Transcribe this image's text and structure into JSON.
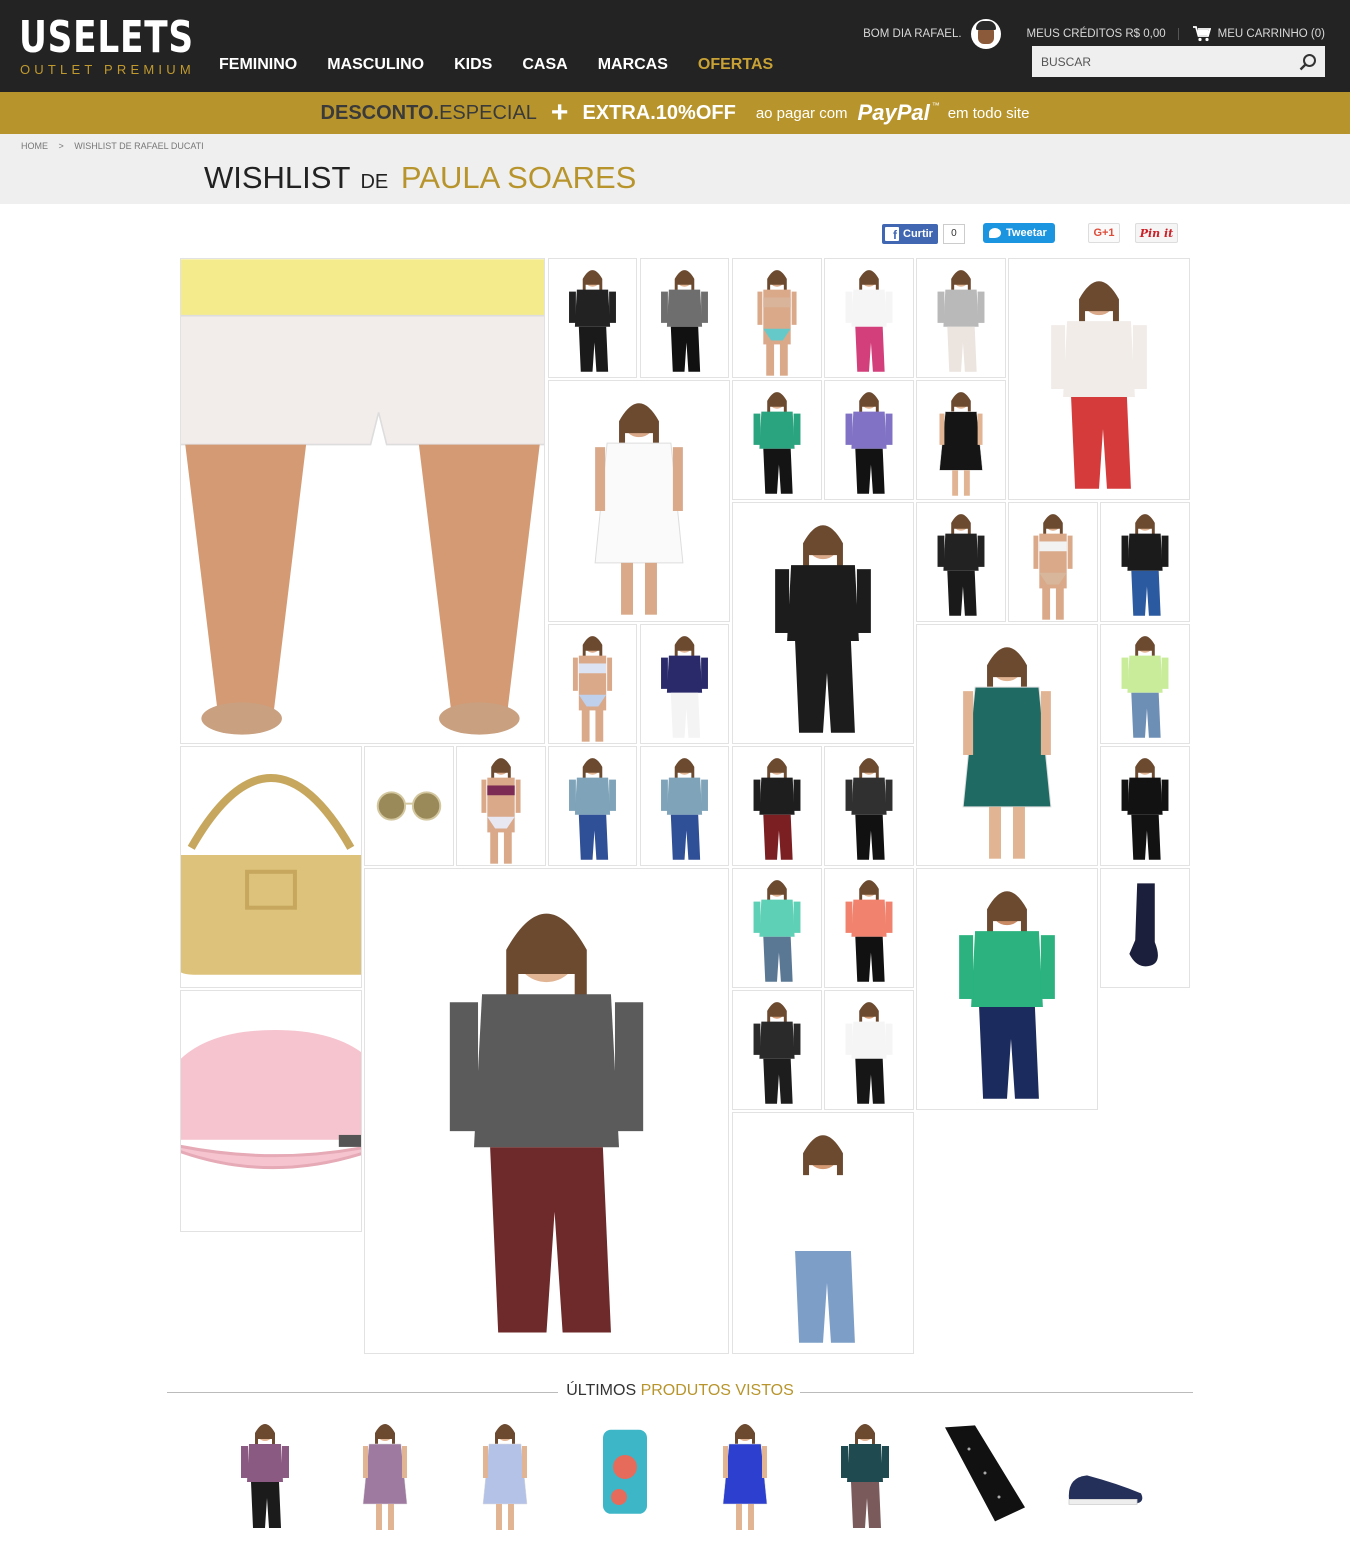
{
  "header": {
    "logo_main": "USELETS",
    "logo_sub": "OUTLET PREMIUM",
    "greeting": "BOM DIA RAFAEL.",
    "credits": "MEUS CRÉDITOS R$ 0,00",
    "cart": "MEU CARRINHO (0)",
    "search_placeholder": "BUSCAR",
    "nav": [
      "FEMININO",
      "MASCULINO",
      "KIDS",
      "CASA",
      "MARCAS",
      "OFERTAS"
    ]
  },
  "promo": {
    "part1": "DESCONTO.",
    "part2": "ESPECIAL",
    "plus": "+",
    "part3": "EXTRA.10%OFF",
    "part4": "ao pagar com",
    "paypal": "PayPal",
    "tm": "™",
    "part5": "em todo site"
  },
  "breadcrumb": [
    "HOME",
    ">",
    "WISHLIST DE RAFAEL DUCATI"
  ],
  "page_title": {
    "prefix": "WISHLIST",
    "de": "DE",
    "name": "PAULA SOARES"
  },
  "social": {
    "facebook_label": "Curtir",
    "facebook_count": "0",
    "twitter_label": "Tweetar",
    "gplus_label": "G+1",
    "pinterest_label": "Pin it"
  },
  "recent": {
    "title_a": "ÚLTIMOS",
    "title_b": "PRODUTOS VISTOS"
  },
  "colors": {
    "header_bg": "#232323",
    "accent": "#b8952c",
    "title_band": "#efefef"
  },
  "tiles": [
    {
      "type": "model-shorts",
      "top": "#f4ec8c",
      "bottom": "#f2ecea",
      "skin": "#d49a73"
    },
    {
      "type": "model-tee",
      "top": "#222222",
      "bottom": "#1a1a1a",
      "skin": "#e1b493"
    },
    {
      "type": "model-tee",
      "top": "#6e6e6e",
      "bottom": "#111111",
      "skin": "#e1b493"
    },
    {
      "type": "model-swim",
      "top": "#d9b49a",
      "bottom": "#66c9c9",
      "skin": "#d9a98a"
    },
    {
      "type": "model-tee",
      "top": "#f5f5f5",
      "bottom": "#d33f7b",
      "skin": "#e1b493"
    },
    {
      "type": "model-tee",
      "top": "#b9b9b9",
      "bottom": "#ece4de",
      "skin": "#e1b493"
    },
    {
      "type": "model-tee",
      "top": "#f1ece8",
      "bottom": "#d53b3b",
      "skin": "#d9a98a"
    },
    {
      "type": "model-dress",
      "top": "#fafafa",
      "bottom": "#fafafa",
      "skin": "#d9a98a"
    },
    {
      "type": "model-tee",
      "top": "#2aa37f",
      "bottom": "#141414",
      "skin": "#e1b493"
    },
    {
      "type": "model-tee",
      "top": "#8172c5",
      "bottom": "#121212",
      "skin": "#e1b493"
    },
    {
      "type": "model-dress",
      "top": "#151515",
      "bottom": "#151515",
      "skin": "#e1b493"
    },
    {
      "type": "model-tee",
      "top": "#1c1c1c",
      "bottom": "#1c1c1c",
      "skin": "#d9a98a"
    },
    {
      "type": "model-tee",
      "top": "#222222",
      "bottom": "#1a1a1a",
      "skin": "#e1b493"
    },
    {
      "type": "model-swim",
      "top": "#f2f2f2",
      "bottom": "#d8b69b",
      "skin": "#d9a98a"
    },
    {
      "type": "model-tee",
      "top": "#1b1b1b",
      "bottom": "#2c5aa0",
      "skin": "#e1b493"
    },
    {
      "type": "model-swim",
      "top": "#dce3f2",
      "bottom": "#bfd0ec",
      "skin": "#d9a98a"
    },
    {
      "type": "model-tee",
      "top": "#2a2a6b",
      "bottom": "#f4f4f4",
      "skin": "#e1b493"
    },
    {
      "type": "model-dress",
      "top": "#1f6b63",
      "bottom": "#1f6b63",
      "skin": "#e1b493"
    },
    {
      "type": "model-tee",
      "top": "#c9ec9b",
      "bottom": "#6e8fb5",
      "skin": "#e1b493"
    },
    {
      "type": "bag",
      "top": "#dcc27a",
      "bottom": "#c6a75d",
      "skin": "#ffffff"
    },
    {
      "type": "sunglasses",
      "top": "#d3c7a0",
      "bottom": "#9b8a59",
      "skin": "#ffffff"
    },
    {
      "type": "model-swim",
      "top": "#7c2c54",
      "bottom": "#e8e8f3",
      "skin": "#d9a98a"
    },
    {
      "type": "model-tee",
      "top": "#7fa3b9",
      "bottom": "#2f4f96",
      "skin": "#e1b493"
    },
    {
      "type": "model-tee",
      "top": "#7fa3b9",
      "bottom": "#2f4f96",
      "skin": "#e1b493"
    },
    {
      "type": "model-tee",
      "top": "#1e1e1e",
      "bottom": "#7c1f22",
      "skin": "#e1b493"
    },
    {
      "type": "model-tee",
      "top": "#303030",
      "bottom": "#111111",
      "skin": "#e1b493"
    },
    {
      "type": "model-tee",
      "top": "#121212",
      "bottom": "#121212",
      "skin": "#e1b493"
    },
    {
      "type": "sock",
      "top": "#1b1f3b",
      "bottom": "#1b1f3b",
      "skin": "#ffffff"
    },
    {
      "type": "model-tee",
      "top": "#5ed0b6",
      "bottom": "#5a7894",
      "skin": "#e1b493"
    },
    {
      "type": "model-tee",
      "top": "#f1826e",
      "bottom": "#111111",
      "skin": "#e1b493"
    },
    {
      "type": "model-tee",
      "top": "#2bb27e",
      "bottom": "#1b2b5d",
      "skin": "#c98a64"
    },
    {
      "type": "cap",
      "top": "#f5c4cf",
      "bottom": "#f5c4cf",
      "skin": "#ffffff"
    },
    {
      "type": "model-tee",
      "top": "#5b5b5b",
      "bottom": "#6e2a2a",
      "skin": "#e1b493"
    },
    {
      "type": "model-tee",
      "top": "#2a2a2a",
      "bottom": "#1d1d1d",
      "skin": "#d49a73"
    },
    {
      "type": "model-tee",
      "top": "#f5f5f5",
      "bottom": "#161616",
      "skin": "#d49a73"
    },
    {
      "type": "model-tee",
      "top": "#ffffff",
      "bottom": "#7c9ec7",
      "skin": "#d49a73"
    }
  ],
  "recent_items": [
    {
      "type": "model-tee",
      "top": "#8b5a83",
      "bottom": "#1b1b1b",
      "skin": "#e1b493"
    },
    {
      "type": "model-dress",
      "top": "#9f7aa0",
      "bottom": "#9f7aa0",
      "skin": "#e1b493"
    },
    {
      "type": "model-dress",
      "top": "#b5c2e8",
      "bottom": "#b5c2e8",
      "skin": "#e1b493"
    },
    {
      "type": "phone-case",
      "top": "#3db6c8",
      "bottom": "#e66b5b",
      "skin": "#ffffff"
    },
    {
      "type": "model-dress",
      "top": "#2c3fcf",
      "bottom": "#2c3fcf",
      "skin": "#e1b493"
    },
    {
      "type": "model-tee",
      "top": "#1f4a4f",
      "bottom": "#7a5a5a",
      "skin": "#e1b493"
    },
    {
      "type": "tie",
      "top": "#111111",
      "bottom": "#111111",
      "skin": "#ffffff"
    },
    {
      "type": "shoe",
      "top": "#25305a",
      "bottom": "#ffffff",
      "skin": "#ffffff"
    }
  ]
}
